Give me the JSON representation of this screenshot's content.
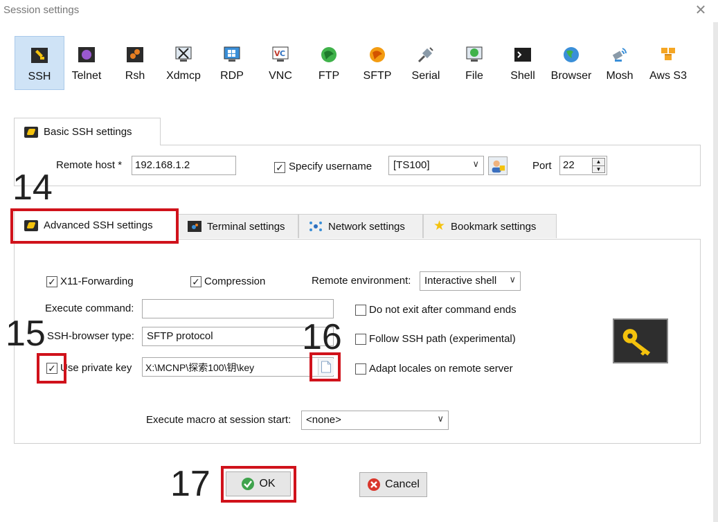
{
  "window": {
    "title": "Session settings"
  },
  "session_types": [
    {
      "label": "SSH",
      "icon": "ssh-icon"
    },
    {
      "label": "Telnet",
      "icon": "telnet-icon"
    },
    {
      "label": "Rsh",
      "icon": "rsh-icon"
    },
    {
      "label": "Xdmcp",
      "icon": "xdmcp-icon"
    },
    {
      "label": "RDP",
      "icon": "rdp-icon"
    },
    {
      "label": "VNC",
      "icon": "vnc-icon"
    },
    {
      "label": "FTP",
      "icon": "ftp-icon"
    },
    {
      "label": "SFTP",
      "icon": "sftp-icon"
    },
    {
      "label": "Serial",
      "icon": "serial-icon"
    },
    {
      "label": "File",
      "icon": "file-icon"
    },
    {
      "label": "Shell",
      "icon": "shell-icon"
    },
    {
      "label": "Browser",
      "icon": "browser-icon"
    },
    {
      "label": "Mosh",
      "icon": "mosh-icon"
    },
    {
      "label": "Aws S3",
      "icon": "aws-s3-icon"
    }
  ],
  "basic": {
    "tab_label": "Basic SSH settings",
    "remote_host_label": "Remote host *",
    "remote_host_value": "192.168.1.2",
    "specify_username_label": "Specify username",
    "username_value": "[TS100]",
    "port_label": "Port",
    "port_value": "22"
  },
  "tabs": {
    "advanced": "Advanced SSH settings",
    "terminal": "Terminal settings",
    "network": "Network settings",
    "bookmark": "Bookmark settings"
  },
  "advanced": {
    "x11_label": "X11-Forwarding",
    "compression_label": "Compression",
    "remote_env_label": "Remote environment:",
    "remote_env_value": "Interactive shell",
    "execute_command_label": "Execute command:",
    "execute_command_value": "",
    "do_not_exit_label": "Do not exit after command ends",
    "browser_type_label": "SSH-browser type:",
    "browser_type_value": "SFTP protocol",
    "follow_path_label": "Follow SSH path (experimental)",
    "use_key_label": "Use private key",
    "key_path_value": "X:\\MCNP\\探索100\\钥\\key",
    "adapt_locales_label": "Adapt locales on remote server",
    "macro_label": "Execute macro at session start:",
    "macro_value": "<none>"
  },
  "buttons": {
    "ok": "OK",
    "cancel": "Cancel"
  },
  "annotations": {
    "a14": "14",
    "a15": "15",
    "a16": "16",
    "a17": "17"
  },
  "colors": {
    "highlight_red": "#d0121b",
    "selected_blue": "#cfe3f6",
    "key_yellow": "#f4c20d"
  }
}
